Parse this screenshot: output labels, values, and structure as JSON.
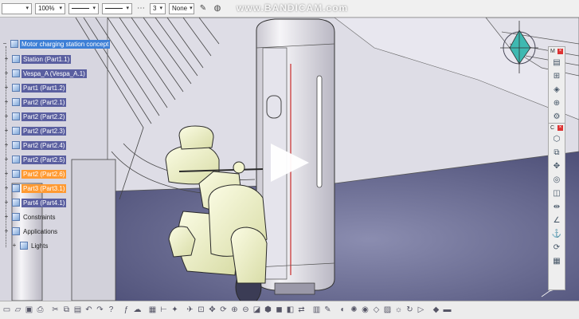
{
  "toolbar": {
    "color_box": "",
    "zoom": "100%",
    "line_type_1": "",
    "line_type_2": "",
    "line_weight": "3",
    "layer": "None",
    "paint_icon": "paint-brush-icon",
    "palette_icon": "palette-icon"
  },
  "watermark": "www.BANDICAM.com",
  "tree": {
    "root": "Motor charging station concept",
    "items": [
      {
        "label": "Station (Part1.1)",
        "state": "normal"
      },
      {
        "label": "Vespa_A (Vespa_A.1)",
        "state": "normal"
      },
      {
        "label": "Part1 (Part1.2)",
        "state": "normal"
      },
      {
        "label": "Part2 (Part2.1)",
        "state": "normal"
      },
      {
        "label": "Part2 (Part2.2)",
        "state": "normal"
      },
      {
        "label": "Part2 (Part2.3)",
        "state": "normal"
      },
      {
        "label": "Part2 (Part2.4)",
        "state": "normal"
      },
      {
        "label": "Part2 (Part2.5)",
        "state": "normal"
      },
      {
        "label": "Part2 (Part2.6)",
        "state": "orange"
      },
      {
        "label": "Part3 (Part3.1)",
        "state": "orange"
      },
      {
        "label": "Part4 (Part4.1)",
        "state": "normal"
      },
      {
        "label": "Constraints",
        "state": "plain"
      },
      {
        "label": "Applications",
        "state": "plain"
      },
      {
        "label": "Lights",
        "state": "plain"
      }
    ]
  },
  "right_toolbar_1": {
    "label": "M"
  },
  "right_toolbar_2": {
    "label": "C"
  },
  "colors": {
    "tree_highlight": "#5a5fa0",
    "tree_selected": "#ff9a32",
    "root_highlight": "#3d7fd6",
    "scooter_body": "#f3f5cf",
    "station": "#eae8ef",
    "floor": "#5d5f86"
  }
}
